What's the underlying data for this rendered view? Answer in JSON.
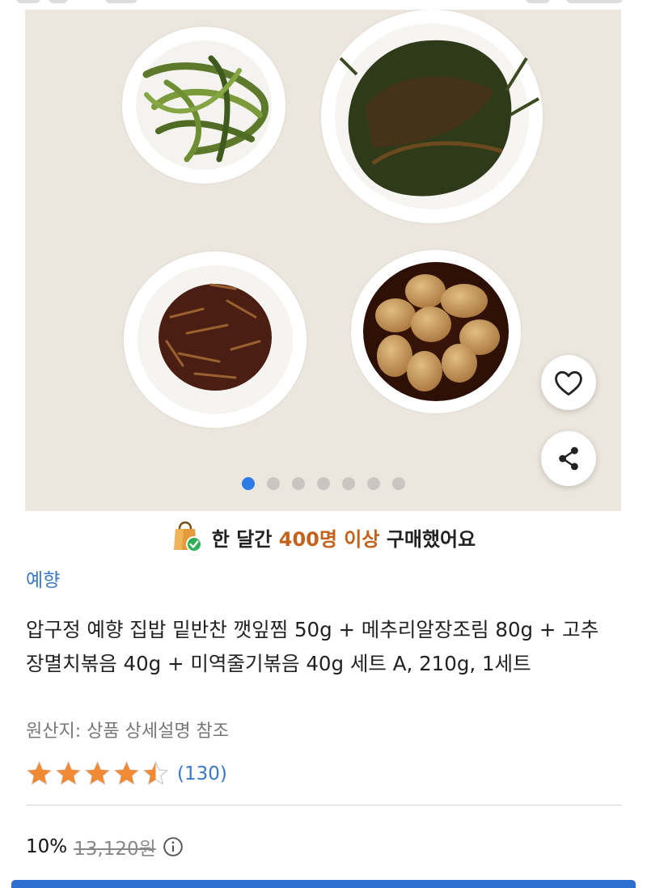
{
  "product": {
    "brand": "예향",
    "title": "압구정 예향 집밥 밑반찬 깻잎찜 50g + 메추리알장조림 80g + 고추장멸치볶음 40g + 미역줄기볶음 40g 세트 A, 210g, 1세트",
    "origin": "원산지: 상품 상세설명 참조",
    "rating": 4.5,
    "review_count": "(130)",
    "discount": "10%",
    "original_price": "13,120원"
  },
  "social_proof": {
    "prefix": "한 달간",
    "highlight": "400명 이상",
    "suffix": "구매했어요"
  },
  "gallery": {
    "image_count": 7,
    "current_index": 0
  },
  "icons": {
    "favorite": "heart-icon",
    "share": "share-icon",
    "shopping_bag": "shopping-bag-check-icon",
    "info": "info-icon"
  },
  "colors": {
    "accent": "#2f7be5",
    "link": "#3a78c9",
    "highlight": "#c4611a",
    "star": "#f08a34"
  }
}
